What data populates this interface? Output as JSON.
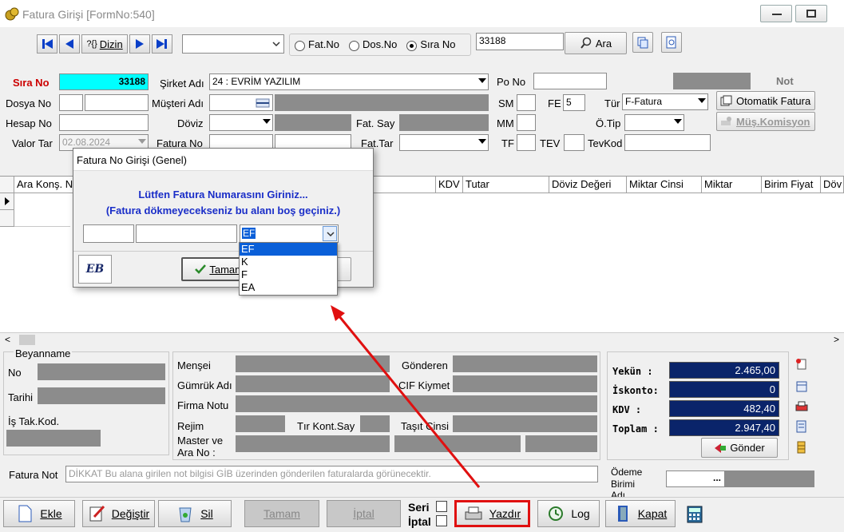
{
  "window": {
    "title": "Fatura Girişi [FormNo:540]"
  },
  "toolbar": {
    "dizin_label": "Dizin",
    "search_value": "33188",
    "ara_label": "Ara",
    "radios": [
      {
        "label": "Fat.No",
        "selected": false
      },
      {
        "label": "Dos.No",
        "selected": false
      },
      {
        "label": "Sıra No",
        "selected": true
      }
    ]
  },
  "form": {
    "sira_no_label": "Sıra No",
    "sira_no_value": "33188",
    "dosya_no_label": "Dosya No",
    "hesap_no_label": "Hesap No",
    "valor_tar_label": "Valor Tar",
    "valor_tar_value": "02.08.2024",
    "sirket_adi_label": "Şirket Adı",
    "sirket_adi_value": "24 : EVRİM YAZILIM",
    "musteri_adi_label": "Müşteri Adı",
    "doviz_label": "Döviz",
    "fatura_no_label": "Fatura No",
    "fat_say_label": "Fat. Say",
    "fat_tar_label": "Fat.Tar",
    "po_no_label": "Po No",
    "not_label": "Not",
    "sm_label": "SM",
    "fe_label": "FE",
    "fe_value": "5",
    "tur_label": "Tür",
    "tur_value": "F-Fatura",
    "mm_label": "MM",
    "otip_label": "Ö.Tip",
    "tf_label": "TF",
    "tev_label": "TEV",
    "tevkod_label": "TevKod",
    "otomatik_fatura_label": "Otomatik Fatura",
    "mus_komisyon_label": "Müş.Komisyon"
  },
  "grid": {
    "columns": [
      "Ara Konş. N",
      "KDV",
      "Tutar",
      "Döviz Değeri",
      "Miktar Cinsi",
      "Miktar",
      "Birim Fiyat",
      "Döv"
    ]
  },
  "dialog": {
    "title": "Fatura No Girişi (Genel)",
    "line1": "Lütfen Fatura Numarasını Giriniz...",
    "line2": "(Fatura dökmeyecekseniz bu alanı boş geçiniz.)",
    "select_value": "EF",
    "options": [
      "EF",
      "K",
      "F",
      "EA"
    ],
    "ok_label": "Tamam",
    "logo_text": "EB"
  },
  "lower": {
    "beyanname_label": "Beyanname",
    "no_label": "No",
    "tarihi_label": "Tarihi",
    "is_tak_kod_label": "İş Tak.Kod.",
    "mensei_label": "Menşei",
    "gonderen_label": "Gönderen",
    "gumruk_adi_label": "Gümrük Adı",
    "cif_kiymet_label": "CIF Kiymet",
    "firma_notu_label": "Firma Notu",
    "rejim_label": "Rejim",
    "tir_kont_say_label": "Tır Kont.Say",
    "tasit_cinsi_label": "Taşıt Cinsi",
    "master_ve_label": "Master ve",
    "ara_no_label": "Ara No :",
    "fatura_not_label": "Fatura Not",
    "fatura_not_value": "DİKKAT Bu alana girilen not bilgisi GİB üzerinden gönderilen faturalarda görünecektir.",
    "odeme_label": "Ödeme",
    "birimi_label": "Birimi",
    "adi_label": "Adı",
    "odeme_btn": "..."
  },
  "totals": {
    "yekun_label": "Yekün  :",
    "yekun_value": "2.465,00",
    "iskonto_label": "İskonto:",
    "iskonto_value": "0",
    "kdv_label": "KDV    :",
    "kdv_value": "482,40",
    "toplam_label": "Toplam :",
    "toplam_value": "2.947,40",
    "gonder_label": "Gönder"
  },
  "bottom": {
    "ekle": "Ekle",
    "degistir": "Değiştir",
    "sil": "Sil",
    "tamam": "Tamam",
    "iptal": "İptal",
    "seri_label": "Seri",
    "iptal_label": "İptal",
    "yazdir": "Yazdır",
    "log": "Log",
    "kapat": "Kapat"
  },
  "colors": {
    "cyan": "#00ffff",
    "navy": "#0a246a",
    "red": "#e01010",
    "highlight": "#0a5fd8"
  }
}
